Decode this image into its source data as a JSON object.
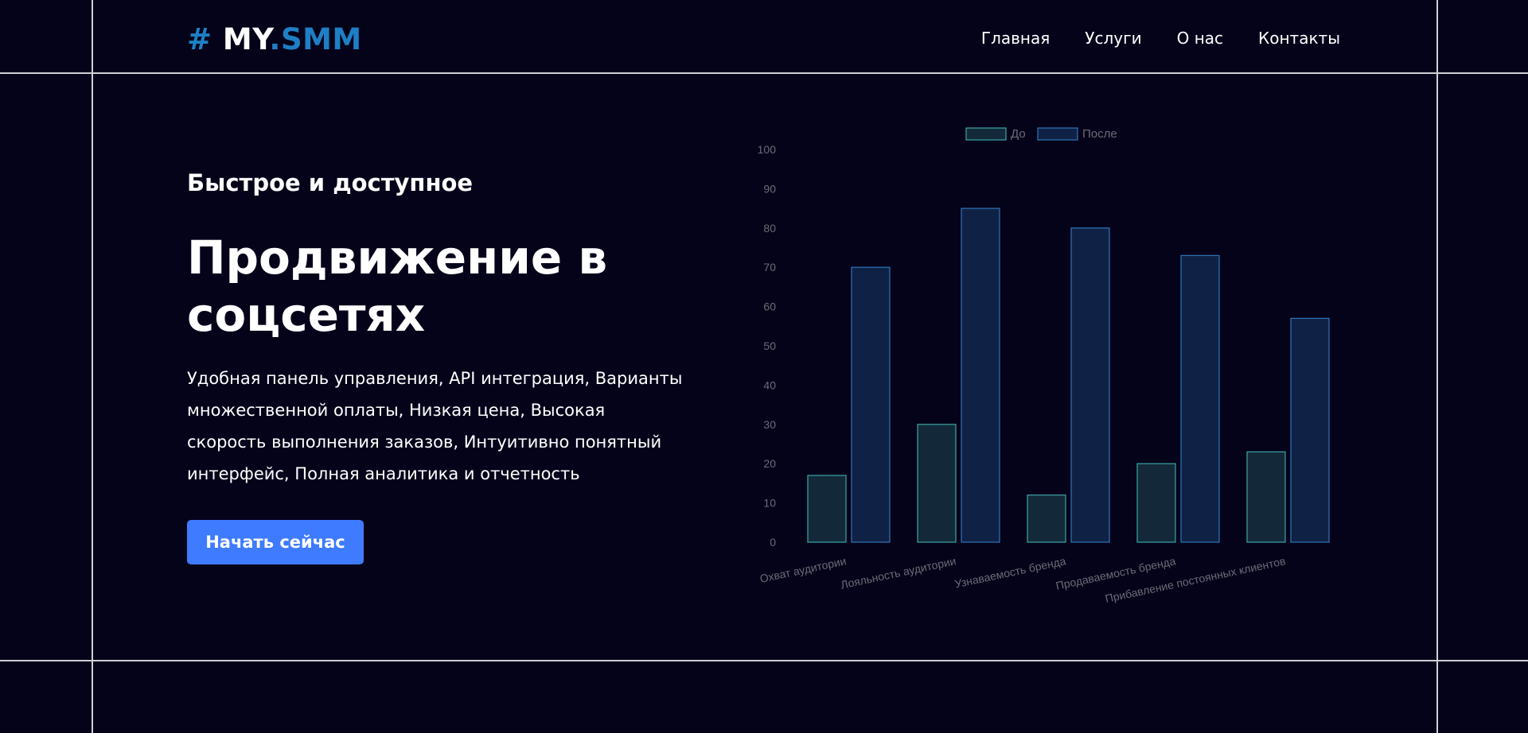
{
  "logo": {
    "hash": "#",
    "my": "MY",
    "dot": ".",
    "smm": "SMM"
  },
  "nav": {
    "items": [
      "Главная",
      "Услуги",
      "О нас",
      "Контакты"
    ]
  },
  "hero": {
    "subtitle": "Быстрое и доступное",
    "title": "Продвижение в соцсетях",
    "description": "Удобная панель управления, API интеграция, Варианты множественной оплаты, Низкая цена, Высокая скорость выполнения заказов, Интуитивно понятный интерфейс, Полная аналитика и отчетность",
    "cta_label": "Начать сейчас"
  },
  "colors": {
    "background": "#05031a",
    "accent": "#1e7fc4",
    "button": "#3e7bff",
    "before_fill": "#132939",
    "before_stroke": "#3aa6a6",
    "after_fill": "#0f2246",
    "after_stroke": "#2f74b8"
  },
  "chart_data": {
    "type": "bar",
    "categories": [
      "Охват аудитории",
      "Лояльность аудитории",
      "Узнаваемость бренда",
      "Продаваемость бренда",
      "Прибавление постоянных клиентов"
    ],
    "series": [
      {
        "name": "До",
        "values": [
          17,
          30,
          12,
          20,
          23
        ]
      },
      {
        "name": "После",
        "values": [
          70,
          85,
          80,
          73,
          57
        ]
      }
    ],
    "yticks": [
      0,
      10,
      20,
      30,
      40,
      50,
      60,
      70,
      80,
      90,
      100
    ],
    "ylim": [
      0,
      100
    ],
    "grid": false,
    "legend_position": "top-center",
    "tick_label_rotation": "tilted"
  }
}
